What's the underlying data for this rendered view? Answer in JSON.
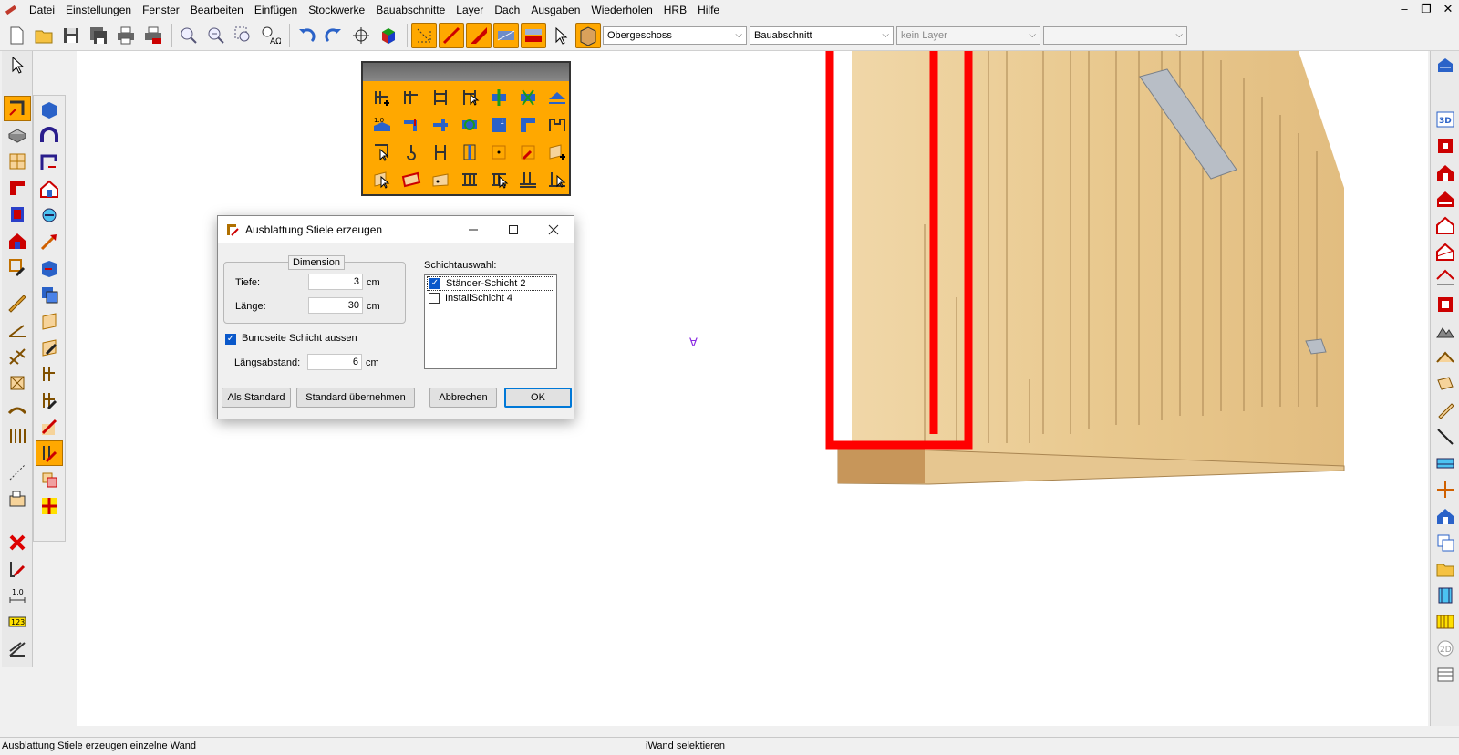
{
  "menu": [
    "Datei",
    "Einstellungen",
    "Fenster",
    "Bearbeiten",
    "Einfügen",
    "Stockwerke",
    "Bauabschnitte",
    "Layer",
    "Dach",
    "Ausgaben",
    "Wiederholen",
    "HRB",
    "Hilfe"
  ],
  "window_controls": {
    "minimize": "–",
    "restore": "❐",
    "close": "✕"
  },
  "toolbar": {
    "floor_select": "Obergeschoss",
    "section_select": "Bauabschnitt",
    "layer_select": "kein Layer",
    "extra_select": ""
  },
  "dialog": {
    "title": "Ausblattung Stiele erzeugen",
    "group_label": "Dimension",
    "tiefe_label": "Tiefe:",
    "tiefe_value": "3",
    "tiefe_unit": "cm",
    "laenge_label": "Länge:",
    "laenge_value": "30",
    "laenge_unit": "cm",
    "bundseite_label": "Bundseite Schicht aussen",
    "bundseite_checked": true,
    "laengsabstand_label": "Längsabstand:",
    "laengsabstand_value": "6",
    "laengsabstand_unit": "cm",
    "schicht_label": "Schichtauswahl:",
    "layers": [
      {
        "label": "Ständer-Schicht 2",
        "checked": true
      },
      {
        "label": "InstallSchicht 4",
        "checked": false
      }
    ],
    "buttons": {
      "als_standard": "Als Standard",
      "standard_uebernehmen": "Standard übernehmen",
      "abbrechen": "Abbrechen",
      "ok": "OK"
    }
  },
  "canvas": {
    "marker": "∀"
  },
  "status": {
    "left": "Ausblattung Stiele erzeugen einzelne Wand",
    "center": "iWand selektieren"
  },
  "colors": {
    "accent": "#ffa800",
    "selection": "#ff0000",
    "wood": "#e8c98f"
  }
}
